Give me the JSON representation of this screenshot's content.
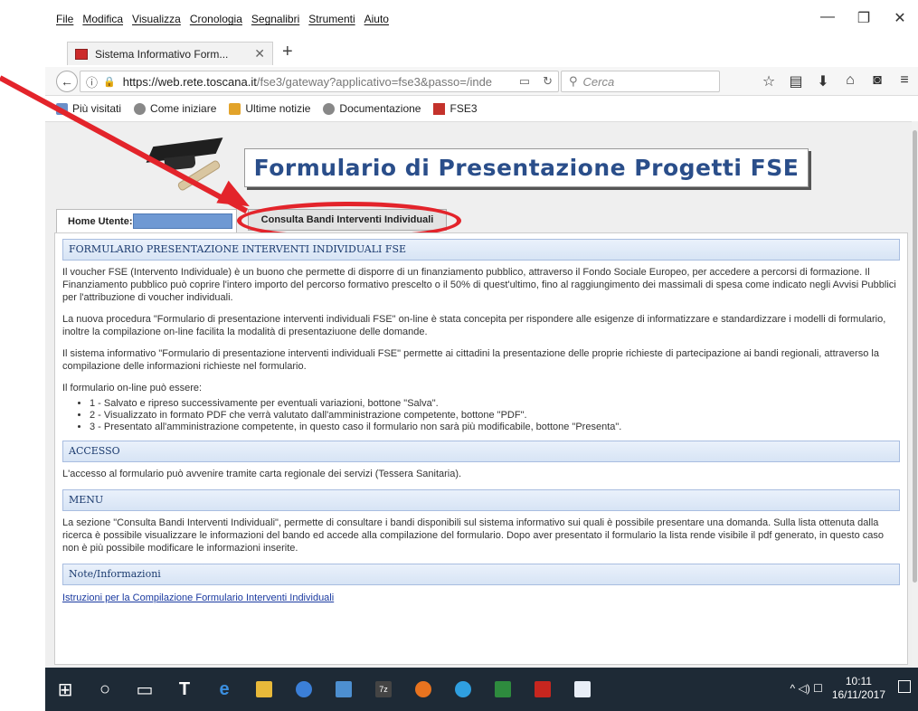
{
  "browser": {
    "menus": [
      "File",
      "Modifica",
      "Visualizza",
      "Cronologia",
      "Segnalibri",
      "Strumenti",
      "Aiuto"
    ],
    "window_controls": [
      "—",
      "❐",
      "✕"
    ],
    "tab_title": "Sistema Informativo Form...",
    "tab_close": "✕",
    "new_tab": "+",
    "url_host": "https://web.rete.toscana.it",
    "url_path": "/fse3/gateway?applicativo=fse3&passo=/inde",
    "search_placeholder": "Cerca",
    "bookmarks": [
      "Più visitati",
      "Come iniziare",
      "Ultime notizie",
      "Documentazione",
      "FSE3"
    ]
  },
  "page": {
    "banner_title": "Formulario di Presentazione Progetti FSE",
    "tab_home_label": "Home Utente:",
    "tab_bandi_label": "Consulta Bandi Interventi Individuali",
    "sections": {
      "intro_title": "FORMULARIO PRESENTAZIONE INTERVENTI INDIVIDUALI FSE",
      "p1": "Il voucher FSE (Intervento Individuale) è un buono che permette di disporre di un finanziamento pubblico, attraverso il Fondo Sociale Europeo, per accedere a percorsi di formazione. Il Finanziamento pubblico può coprire l'intero importo del percorso formativo prescelto o il 50% di quest'ultimo, fino al raggiungimento dei massimali di spesa come indicato negli Avvisi Pubblici per l'attribuzione di voucher individuali.",
      "p2": "La nuova procedura \"Formulario di presentazione interventi individuali FSE\" on-line è stata concepita per rispondere alle esigenze di informatizzare e standardizzare i modelli di formulario, inoltre la compilazione on-line facilita la modalità di presentaziuone delle domande.",
      "p3": "Il sistema informativo \"Formulario di presentazione interventi individuali FSE\" permette ai cittadini la presentazione delle proprie richieste di partecipazione ai bandi regionali, attraverso la compilazione delle informazioni richieste nel formulario.",
      "p4": "Il formulario on-line può essere:",
      "options": [
        "1 - Salvato e ripreso successivamente per eventuali variazioni, bottone \"Salva\".",
        "2 - Visualizzato in formato PDF che verrà valutato dall'amministrazione competente, bottone \"PDF\".",
        "3 - Presentato all'amministrazione competente, in questo caso il formulario non sarà più modificabile, bottone \"Presenta\"."
      ],
      "accesso_title": "ACCESSO",
      "accesso_text": "L'accesso al formulario può avvenire tramite carta regionale dei servizi (Tessera Sanitaria).",
      "menu_title": "MENU",
      "menu_text": "La sezione \"Consulta Bandi Interventi Individuali\", permette di consultare i bandi disponibili sul sistema informativo sui quali è possibile presentare una domanda. Sulla lista ottenuta dalla ricerca è possibile visualizzare le informazioni del bando ed accede alla compilazione del formulario. Dopo aver presentato il formulario la lista rende visibile il pdf generato, in questo caso non è più possibile modificare le informazioni inserite.",
      "note_title": "Note/Informazioni",
      "note_link": "Istruzioni per la Compilazione Formulario Interventi Individuali"
    }
  },
  "taskbar": {
    "time": "10:11",
    "date": "16/11/2017",
    "tray_icons": "^ ◁) ☐"
  }
}
